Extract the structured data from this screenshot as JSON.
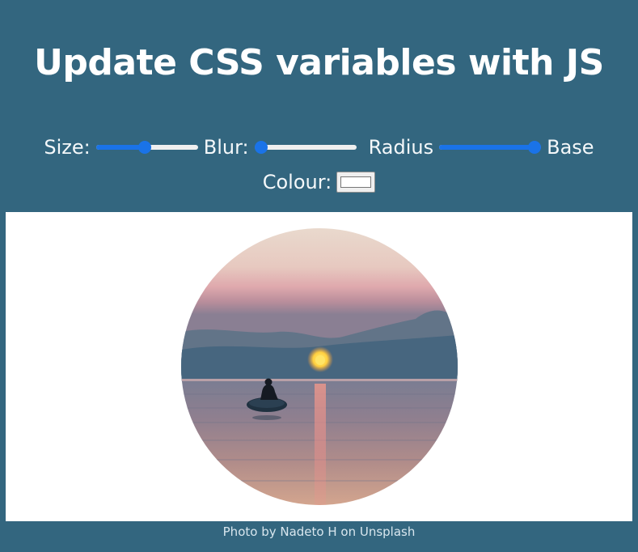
{
  "header": {
    "title": "Update CSS variables with JS"
  },
  "controls": {
    "size_label": "Size:",
    "blur_label": "Blur:",
    "radius_label": "Radius",
    "base_label": "Base",
    "colour_label": "Colour:",
    "size_value_fraction": 0.48,
    "blur_value_fraction": 0.0,
    "radius_value_fraction": 1.0,
    "base_colour": "#ffffff",
    "slider_accent": "#1a73e8"
  },
  "image": {
    "alt": "Silhouette of a person on an inflatable boat at sunset over calm sea"
  },
  "footer": {
    "caption": "Photo by Nadeto H on Unsplash"
  },
  "colors": {
    "page_background": "#33667f",
    "frame_background": "#ffffff"
  }
}
